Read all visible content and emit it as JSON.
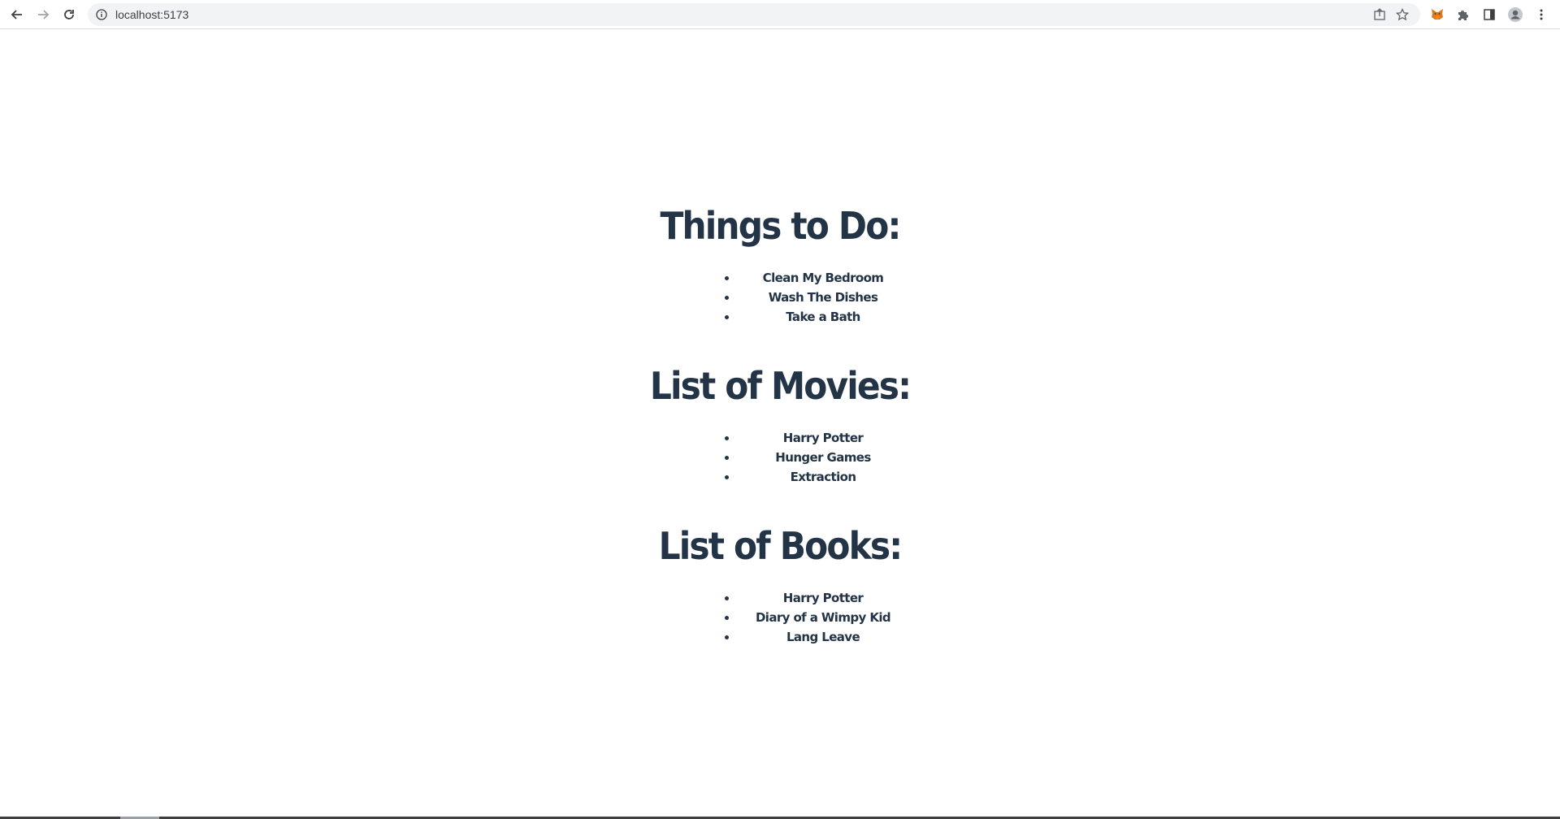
{
  "browser": {
    "url": "localhost:5173",
    "icons": [
      "back-arrow-icon",
      "forward-arrow-icon",
      "reload-icon",
      "info-icon",
      "share-icon",
      "star-icon",
      "metamask-fox-icon",
      "extensions-puzzle-icon",
      "side-panel-icon",
      "profile-avatar-icon",
      "kebab-menu-icon"
    ]
  },
  "sections": [
    {
      "title": "Things to Do:",
      "items": [
        "Clean My Bedroom",
        "Wash The Dishes",
        "Take a Bath"
      ]
    },
    {
      "title": "List of Movies:",
      "items": [
        "Harry Potter",
        "Hunger Games",
        "Extraction"
      ]
    },
    {
      "title": "List of Books:",
      "items": [
        "Harry Potter",
        "Diary of a Wimpy Kid",
        "Lang Leave"
      ]
    }
  ]
}
